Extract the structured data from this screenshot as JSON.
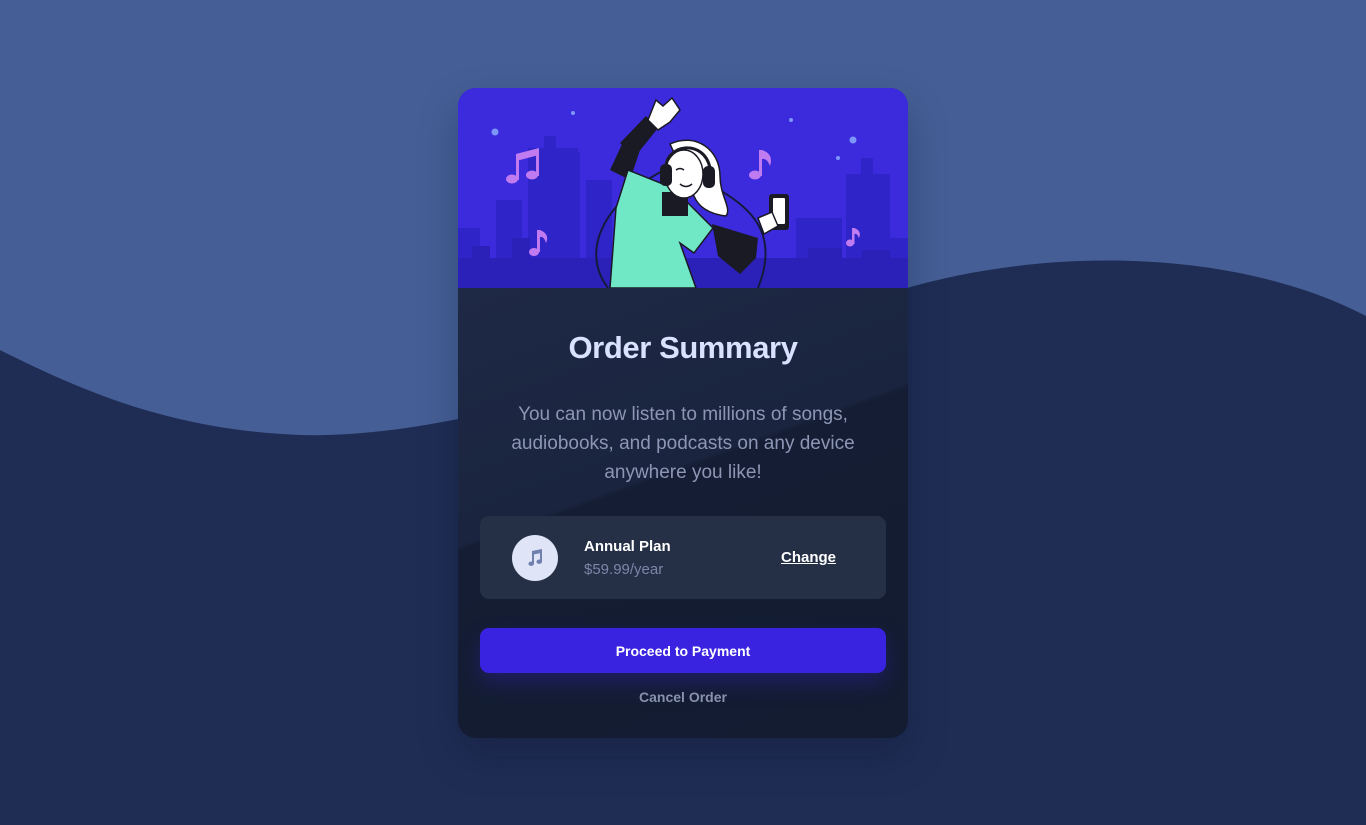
{
  "colors": {
    "background_top": "#455f96",
    "background_bottom": "#1f2d55",
    "card": "#151e36",
    "accent": "#3a23e0",
    "title": "#d9e2ff",
    "muted_text": "#8d97b5"
  },
  "hero": {
    "illustration": "person-dancing-with-headphones-city-night",
    "icons": [
      "music-note-icon",
      "headphones-icon",
      "phone-icon"
    ]
  },
  "summary": {
    "title": "Order Summary",
    "description": "You can now listen to millions of songs, audiobooks, and podcasts on any device anywhere you like!"
  },
  "plan": {
    "icon": "music-note-icon",
    "name": "Annual Plan",
    "price": "$59.99/year",
    "change_label": "Change"
  },
  "actions": {
    "proceed_label": "Proceed to Payment",
    "cancel_label": "Cancel Order"
  }
}
